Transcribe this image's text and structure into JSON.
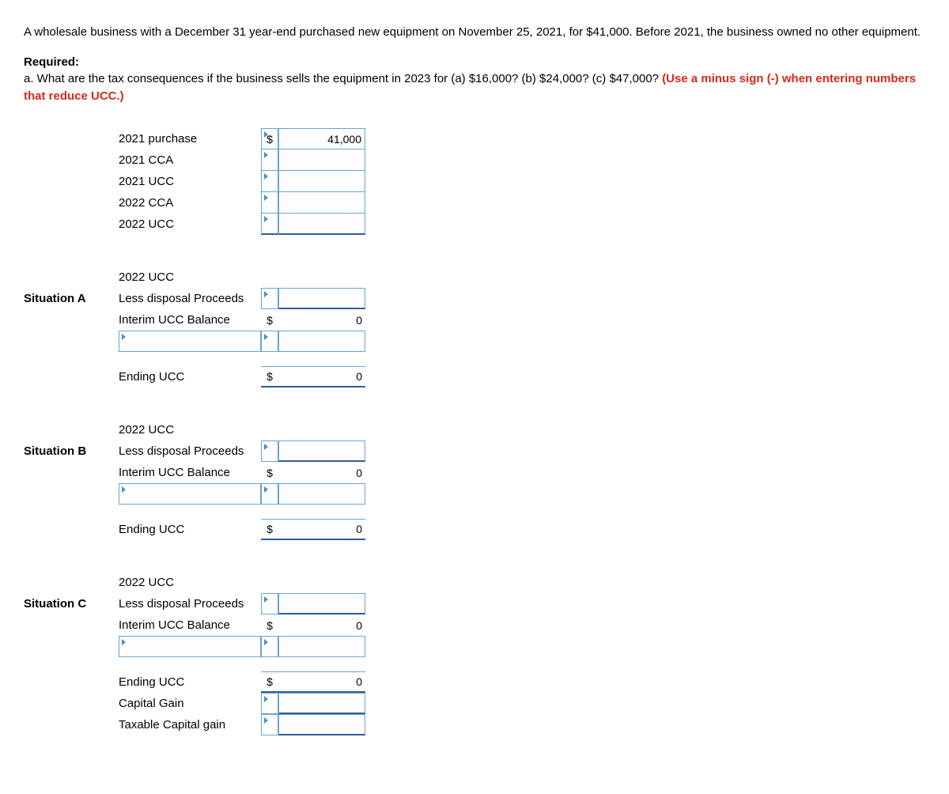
{
  "intro": "A wholesale business with a December 31 year-end purchased new equipment on November 25, 2021, for $41,000. Before 2021, the business owned no other equipment.",
  "required_label": "Required:",
  "required_text": "a. What are the tax consequences if the business sells the equipment in 2023 for (a) $16,000? (b) $24,000? (c) $47,000? ",
  "hint": "(Use a minus sign (-) when entering numbers that reduce UCC.)",
  "labels": {
    "purchase_2021": "2021 purchase",
    "cca_2021": "2021 CCA",
    "ucc_2021": "2021 UCC",
    "cca_2022": "2022 CCA",
    "ucc_2022": "2022 UCC",
    "less_disposal": "Less disposal Proceeds",
    "interim": "Interim UCC Balance",
    "ending": "Ending UCC",
    "capital_gain": "Capital Gain",
    "taxable_cg": "Taxable Capital gain",
    "sit_a": "Situation A",
    "sit_b": "Situation B",
    "sit_c": "Situation C"
  },
  "values": {
    "dollar": "$",
    "purchase_amount": "41,000",
    "zero": "0"
  }
}
